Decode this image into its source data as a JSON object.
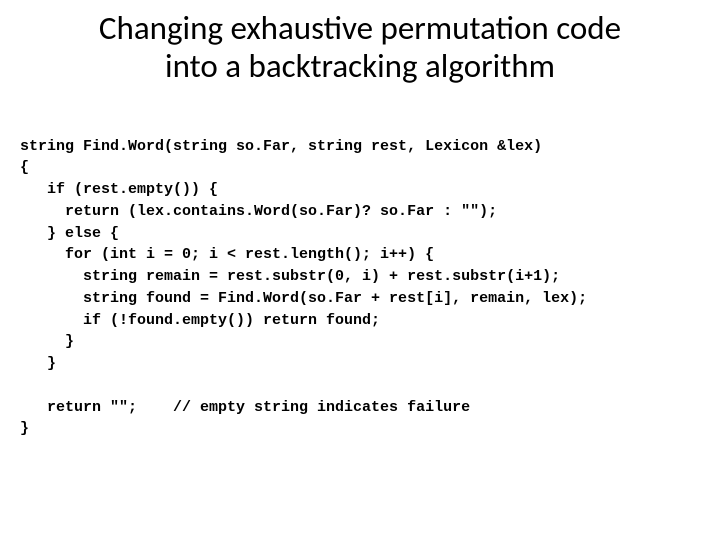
{
  "title_line1": "Changing exhaustive permutation code",
  "title_line2": "into a backtracking algorithm",
  "code": {
    "l1": "string Find.Word(string so.Far, string rest, Lexicon &lex)",
    "l2": "{",
    "l3": "   if (rest.empty()) {",
    "l4": "     return (lex.contains.Word(so.Far)? so.Far : \"\");",
    "l5": "   } else {",
    "l6": "     for (int i = 0; i < rest.length(); i++) {",
    "l7": "       string remain = rest.substr(0, i) + rest.substr(i+1);",
    "l8": "       string found = Find.Word(so.Far + rest[i], remain, lex);",
    "l9": "       if (!found.empty()) return found;",
    "l10": "     }",
    "l11": "   }",
    "l12": "",
    "l13": "   return \"\";    // empty string indicates failure",
    "l14": "}"
  }
}
